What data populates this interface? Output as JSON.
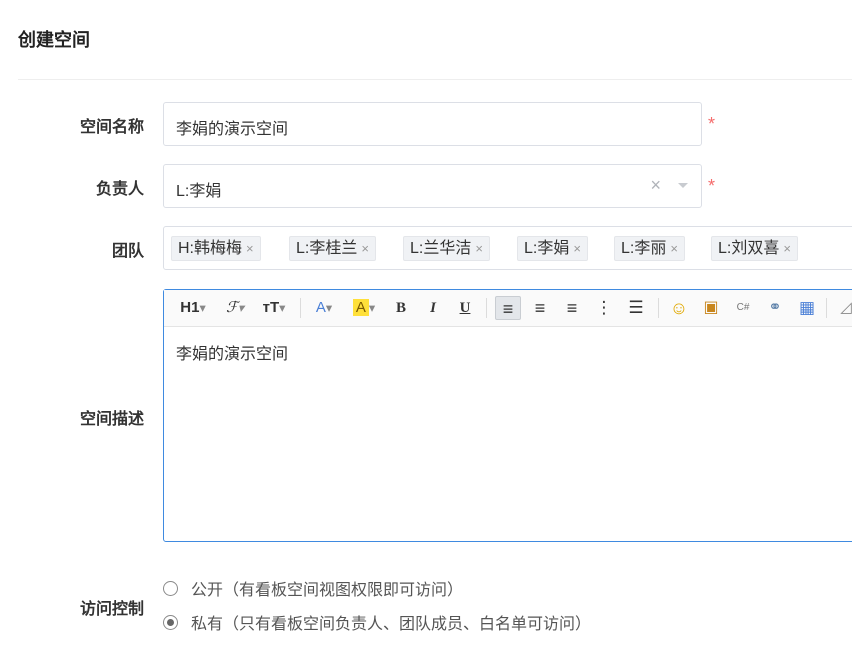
{
  "page": {
    "title": "创建空间"
  },
  "form": {
    "name": {
      "label": "空间名称",
      "value": "李娟的演示空间",
      "required": "*"
    },
    "owner": {
      "label": "负责人",
      "value": "L:李娟",
      "required": "*",
      "clear_icon": "×"
    },
    "team": {
      "label": "团队",
      "tags": [
        "H:韩梅梅",
        "L:李桂兰",
        "L:兰华洁",
        "L:李娟",
        "L:李丽",
        "L:刘双喜"
      ],
      "remove_icon": "×"
    },
    "description": {
      "label": "空间描述",
      "content": "李娟的演示空间",
      "toolbar": {
        "heading": "H1",
        "font_family": "ℱ",
        "font_size": "тT",
        "font_color": "A",
        "highlight": "A",
        "bold": "B",
        "italic": "I",
        "underline": "U",
        "align_left": "≡",
        "align_center": "≡",
        "align_right": "≡",
        "ordered_list": "⋮",
        "unordered_list": "☰",
        "emoji": "☺",
        "image": "▣",
        "code": "C#",
        "link": "⚭",
        "table": "▦",
        "more": "◿"
      }
    },
    "access": {
      "label": "访问控制",
      "options": [
        {
          "label": "公开（有看板空间视图权限即可访问）",
          "checked": false
        },
        {
          "label": "私有（只有看板空间负责人、团队成员、白名单可访问）",
          "checked": true
        }
      ]
    }
  },
  "colors": {
    "required": "#f56c6c",
    "editor_border": "#3f8ae0",
    "highlight": "#ffe03a",
    "font_color_a": "#4a7fd6"
  }
}
